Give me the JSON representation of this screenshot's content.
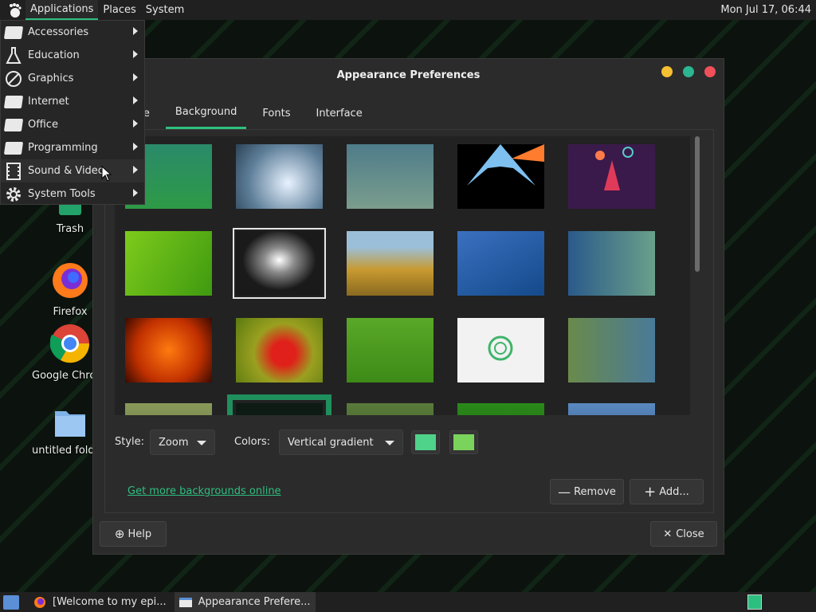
{
  "top_panel": {
    "menus": [
      "Applications",
      "Places",
      "System"
    ],
    "clock": "Mon Jul 17, 06:44"
  },
  "app_menu": {
    "items": [
      {
        "label": "Accessories",
        "icon": "blank-window-icon"
      },
      {
        "label": "Education",
        "icon": "flask-icon"
      },
      {
        "label": "Graphics",
        "icon": "palette-icon"
      },
      {
        "label": "Internet",
        "icon": "blank-window-icon"
      },
      {
        "label": "Office",
        "icon": "blank-window-icon"
      },
      {
        "label": "Programming",
        "icon": "blank-window-icon"
      },
      {
        "label": "Sound & Video",
        "icon": "film-icon"
      },
      {
        "label": "System Tools",
        "icon": "gear-icon"
      }
    ]
  },
  "desktop": {
    "icons": [
      {
        "label": "Trash",
        "icon": "trash-icon"
      },
      {
        "label": "Firefox",
        "icon": "firefox-icon"
      },
      {
        "label": "Google Chrome",
        "icon": "chrome-icon"
      },
      {
        "label": "untitled folder",
        "icon": "folder-icon"
      }
    ]
  },
  "window": {
    "title": "Appearance Preferences",
    "tabs": [
      "Theme",
      "Background",
      "Fonts",
      "Interface"
    ],
    "active_tab": "Background",
    "style_label": "Style:",
    "style_value": "Zoom",
    "colors_label": "Colors:",
    "colors_value": "Vertical gradient",
    "color1": "#4fd38a",
    "color2": "#7ad35a",
    "get_more_link": "Get more backgrounds online",
    "remove_label": "Remove",
    "add_label": "Add...",
    "help_label": "Help",
    "close_label": "Close",
    "accent": "#2dbf7f"
  },
  "taskbar": {
    "items": [
      "[Welcome to my epi...",
      "Appearance Prefere..."
    ]
  }
}
